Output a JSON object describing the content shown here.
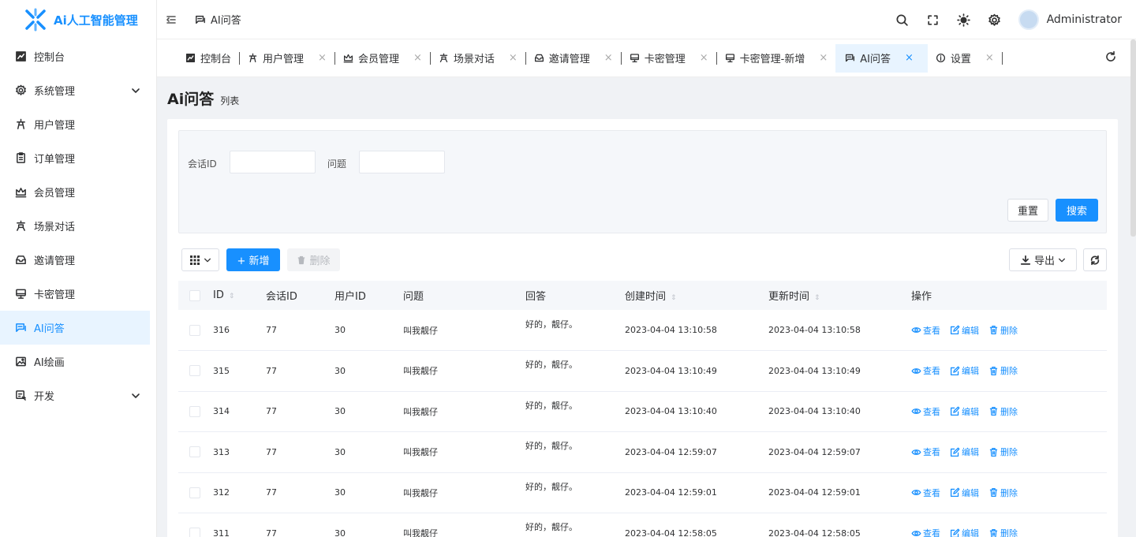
{
  "app": {
    "title": "Ai人工智能管理"
  },
  "header": {
    "breadcrumb": "AI问答",
    "user": "Administrator"
  },
  "sidebar": {
    "items": [
      {
        "label": "控制台",
        "icon": "dashboard-icon"
      },
      {
        "label": "系统管理",
        "icon": "settings-icon"
      },
      {
        "label": "用户管理",
        "icon": "user-icon"
      },
      {
        "label": "订单管理",
        "icon": "order-icon"
      },
      {
        "label": "会员管理",
        "icon": "crown-icon"
      },
      {
        "label": "场景对话",
        "icon": "scene-icon"
      },
      {
        "label": "邀请管理",
        "icon": "invite-icon"
      },
      {
        "label": "卡密管理",
        "icon": "monitor-icon"
      },
      {
        "label": "AI问答",
        "icon": "chat-icon"
      },
      {
        "label": "AI绘画",
        "icon": "image-icon"
      },
      {
        "label": "开发",
        "icon": "dev-icon"
      }
    ]
  },
  "tabs": [
    {
      "label": "控制台"
    },
    {
      "label": "用户管理"
    },
    {
      "label": "会员管理"
    },
    {
      "label": "场景对话"
    },
    {
      "label": "邀请管理"
    },
    {
      "label": "卡密管理"
    },
    {
      "label": "卡密管理-新增"
    },
    {
      "label": "AI问答"
    },
    {
      "label": "设置"
    }
  ],
  "page": {
    "title": "Ai问答",
    "subtitle": "列表"
  },
  "search": {
    "session_label": "会话ID",
    "question_label": "问题",
    "reset": "重置",
    "submit": "搜索"
  },
  "toolbar": {
    "add": "+ 新增",
    "delete": "删除",
    "export": "导出"
  },
  "table": {
    "headers": [
      "ID",
      "会话ID",
      "用户ID",
      "问题",
      "回答",
      "创建时间",
      "更新时间",
      "操作"
    ],
    "ops": {
      "view": "查看",
      "edit": "编辑",
      "delete": "删除"
    },
    "rows": [
      {
        "id": "316",
        "session": "77",
        "user": "30",
        "question": "叫我靓仔",
        "answer": "好的，靓仔。",
        "created": "2023-04-04 13:10:58",
        "updated": "2023-04-04 13:10:58"
      },
      {
        "id": "315",
        "session": "77",
        "user": "30",
        "question": "叫我靓仔",
        "answer": "好的，靓仔。",
        "created": "2023-04-04 13:10:49",
        "updated": "2023-04-04 13:10:49"
      },
      {
        "id": "314",
        "session": "77",
        "user": "30",
        "question": "叫我靓仔",
        "answer": "好的，靓仔。",
        "created": "2023-04-04 13:10:40",
        "updated": "2023-04-04 13:10:40"
      },
      {
        "id": "313",
        "session": "77",
        "user": "30",
        "question": "叫我靓仔",
        "answer": "好的，靓仔。",
        "created": "2023-04-04 12:59:07",
        "updated": "2023-04-04 12:59:07"
      },
      {
        "id": "312",
        "session": "77",
        "user": "30",
        "question": "叫我靓仔",
        "answer": "好的，靓仔。",
        "created": "2023-04-04 12:59:01",
        "updated": "2023-04-04 12:59:01"
      },
      {
        "id": "311",
        "session": "77",
        "user": "30",
        "question": "叫我靓仔",
        "answer": "好的，靓仔。",
        "created": "2023-04-04 12:58:05",
        "updated": "2023-04-04 12:58:05"
      }
    ]
  },
  "colors": {
    "primary": "#1890ff",
    "active_bg": "#e8f4ff"
  }
}
